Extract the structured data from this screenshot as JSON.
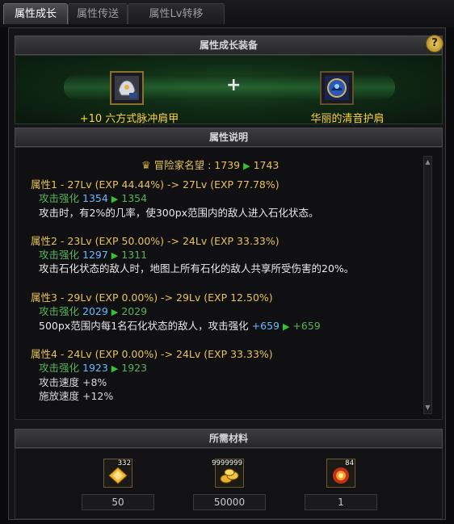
{
  "tabs": [
    {
      "label": "属性成长",
      "active": true
    },
    {
      "label": "属性传送",
      "active": false
    },
    {
      "label": "属性Lv转移",
      "active": false
    }
  ],
  "equip_section": {
    "title": "属性成长装备",
    "help_label": "?",
    "plus": "+",
    "source_item": "+10 六方式脉冲肩甲",
    "target_item": "华丽的清音护肩"
  },
  "desc_section": {
    "title": "属性说明",
    "fame": {
      "label": "冒险家名望 : 1739",
      "arrow": "▶",
      "value": "1743"
    },
    "attributes": [
      {
        "header": "属性1 - 27Lv (EXP 44.44%) -> 27Lv (EXP 77.78%)",
        "stat_name": "攻击强化",
        "stat_from": "1354",
        "arrow": "▶",
        "stat_to": "1354",
        "description": "攻击时，有2%的几率，使300px范围内的敌人进入石化状态。"
      },
      {
        "header": "属性2 - 23Lv (EXP 50.00%) -> 24Lv (EXP 33.33%)",
        "stat_name": "攻击强化",
        "stat_from": "1297",
        "arrow": "▶",
        "stat_to": "1311",
        "description": "攻击石化状态的敌人时，地图上所有石化的敌人共享所受伤害的20%。"
      },
      {
        "header": "属性3 - 29Lv (EXP 0.00%) -> 29Lv (EXP 12.50%)",
        "stat_name": "攻击强化",
        "stat_from": "2029",
        "arrow": "▶",
        "stat_to": "2029",
        "description": "500px范围内每1名石化状态的敌人，攻击强化",
        "bonus_from": "+659",
        "bonus_to": "+659"
      },
      {
        "header": "属性4 - 24Lv (EXP 0.00%) -> 24Lv (EXP 33.33%)",
        "stat_name": "攻击强化",
        "stat_from": "1923",
        "arrow": "▶",
        "stat_to": "1923",
        "extra_lines": [
          "攻击速度 +8%",
          "施放速度 +12%"
        ]
      }
    ]
  },
  "materials_section": {
    "title": "所需材料",
    "items": [
      {
        "icon": "gold-crystal-icon",
        "stack_label": "332",
        "quantity": "50"
      },
      {
        "icon": "gold-coin-icon",
        "stack_label": "9999999",
        "quantity": "50000"
      },
      {
        "icon": "fire-burst-icon",
        "stack_label": "84",
        "quantity": "1"
      }
    ]
  },
  "colors": {
    "gold_text": "#e6c25c",
    "green_text": "#56b25d",
    "blue_value": "#6ab8ff",
    "item_name": "#ffd23a",
    "arrow": "#36c236"
  }
}
